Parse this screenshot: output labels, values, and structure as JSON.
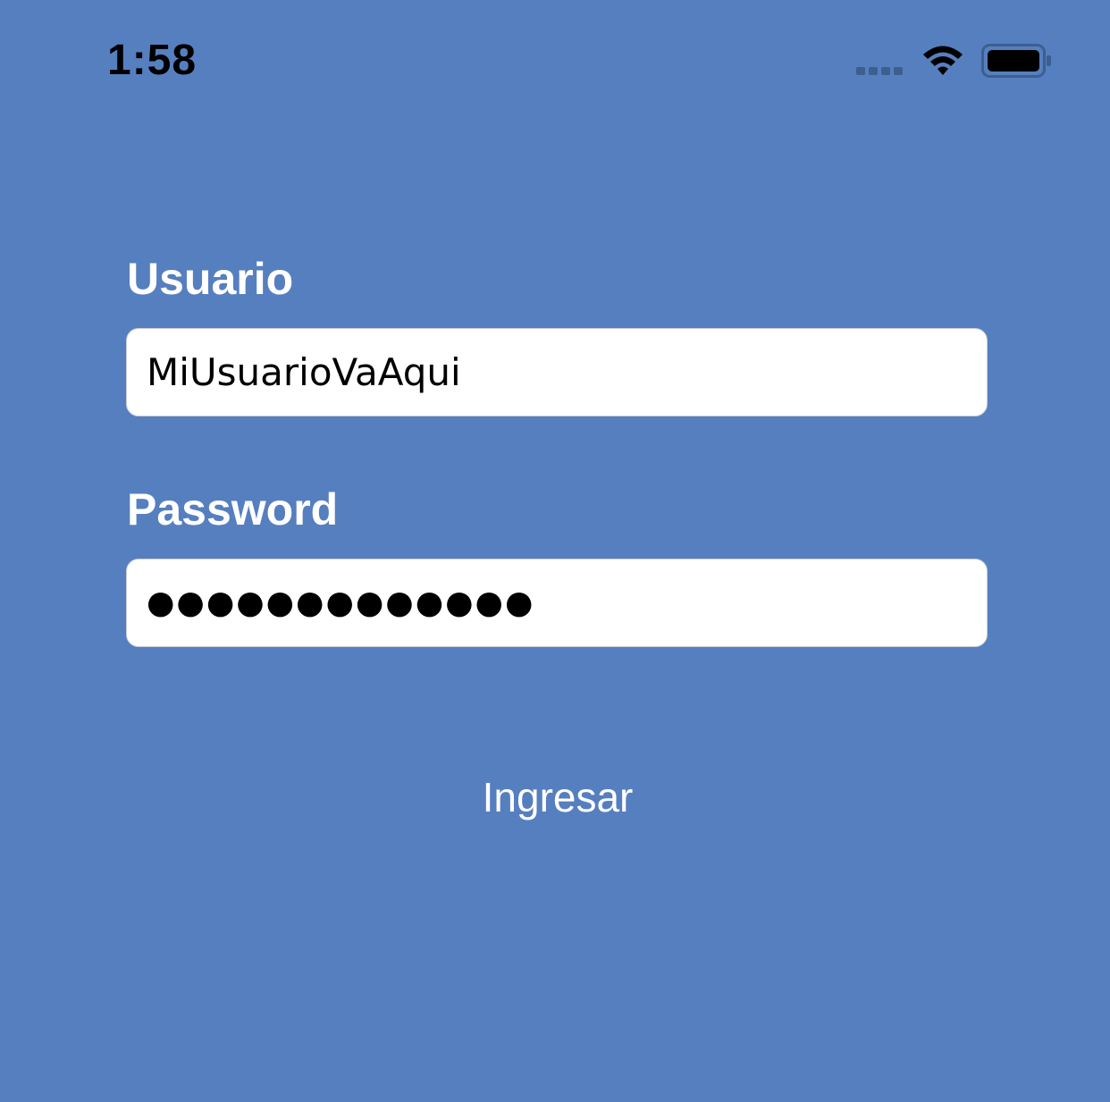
{
  "status_bar": {
    "time": "1:58",
    "signal_icon": "cellular-signal-icon",
    "wifi_icon": "wifi-icon",
    "battery_icon": "battery-icon"
  },
  "form": {
    "user_label": "Usuario",
    "user_value": "MiUsuarioVaAqui",
    "password_label": "Password",
    "password_value": "●●●●●●●●●●●●●",
    "submit_label": "Ingresar"
  },
  "colors": {
    "background": "#567fbf",
    "field_background": "#ffffff",
    "label_text": "#ffffff"
  }
}
